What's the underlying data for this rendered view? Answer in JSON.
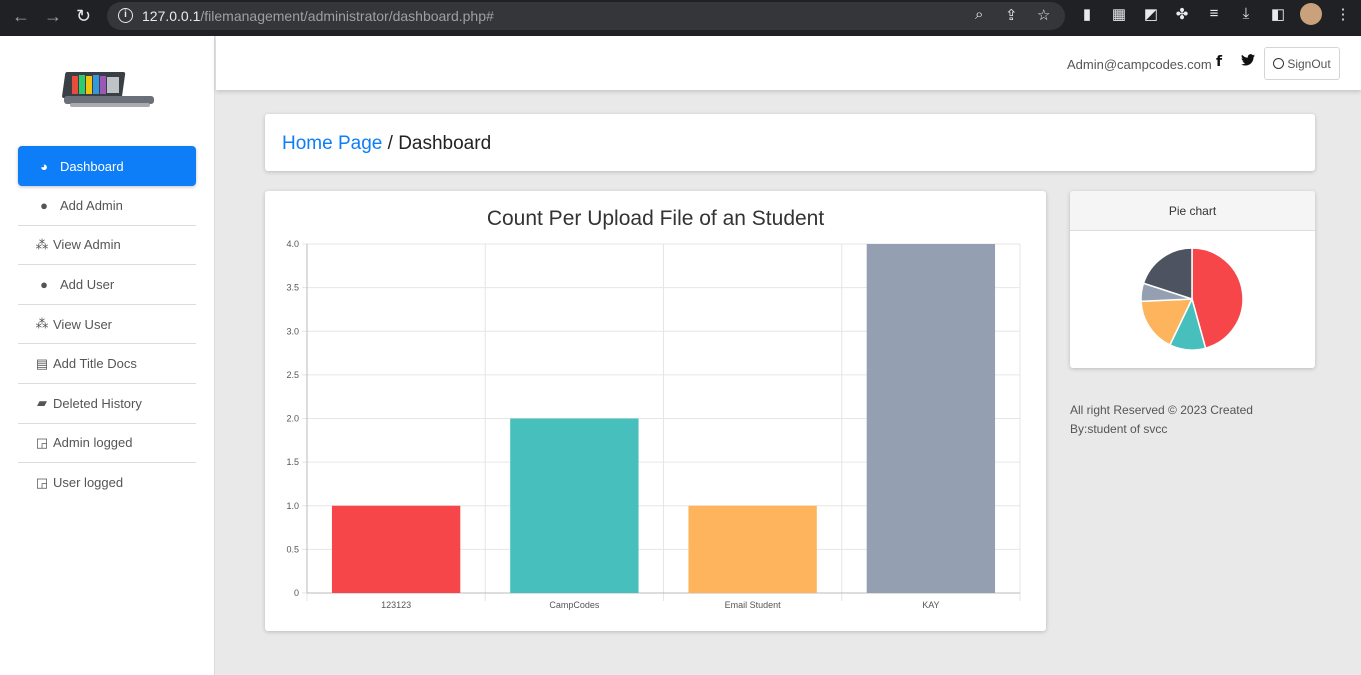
{
  "browser": {
    "url_host": "127.0.0.1",
    "url_path": "/filemanagement/administrator/dashboard.php#"
  },
  "sidebar": {
    "items": [
      {
        "label": "Dashboard",
        "icon": "pie-chart-icon",
        "active": true
      },
      {
        "label": "Add Admin",
        "icon": "user-icon"
      },
      {
        "label": "View Admin",
        "icon": "users-icon"
      },
      {
        "label": "Add User",
        "icon": "user-icon"
      },
      {
        "label": "View User",
        "icon": "users-icon"
      },
      {
        "label": "Add Title Docs",
        "icon": "file-plus-icon"
      },
      {
        "label": "Deleted History",
        "icon": "folder-open-icon"
      },
      {
        "label": "Admin logged",
        "icon": "chalkboard-user-icon"
      },
      {
        "label": "User logged",
        "icon": "chalkboard-user-icon"
      }
    ]
  },
  "header": {
    "admin_email": "Admin@campcodes.com",
    "signout_label": "SignOut"
  },
  "breadcrumb": {
    "home": "Home Page",
    "separator": "/",
    "current": "Dashboard"
  },
  "chart_data": {
    "type": "bar",
    "title": "Count Per Upload File of an Student",
    "categories": [
      "123123",
      "CampCodes",
      "Email Student",
      "KAY"
    ],
    "values": [
      1,
      2,
      1,
      4
    ],
    "colors": [
      "#f7464a",
      "#46bfbd",
      "#fdb45c",
      "#949fb1"
    ],
    "ylim": [
      0,
      4
    ],
    "yticks": [
      "0",
      "0.5",
      "1.0",
      "1.5",
      "2.0",
      "2.5",
      "3.0",
      "3.5",
      "4.0"
    ],
    "grid": true
  },
  "pie": {
    "title": "Pie chart",
    "type": "pie",
    "values": [
      8,
      2,
      3,
      1,
      3.5
    ],
    "colors": [
      "#f7464a",
      "#46bfbd",
      "#fdb45c",
      "#949fb1",
      "#4d5360"
    ]
  },
  "footer": {
    "line1": "All right Reserved © 2023 Created",
    "line2": "By:student of svcc"
  }
}
